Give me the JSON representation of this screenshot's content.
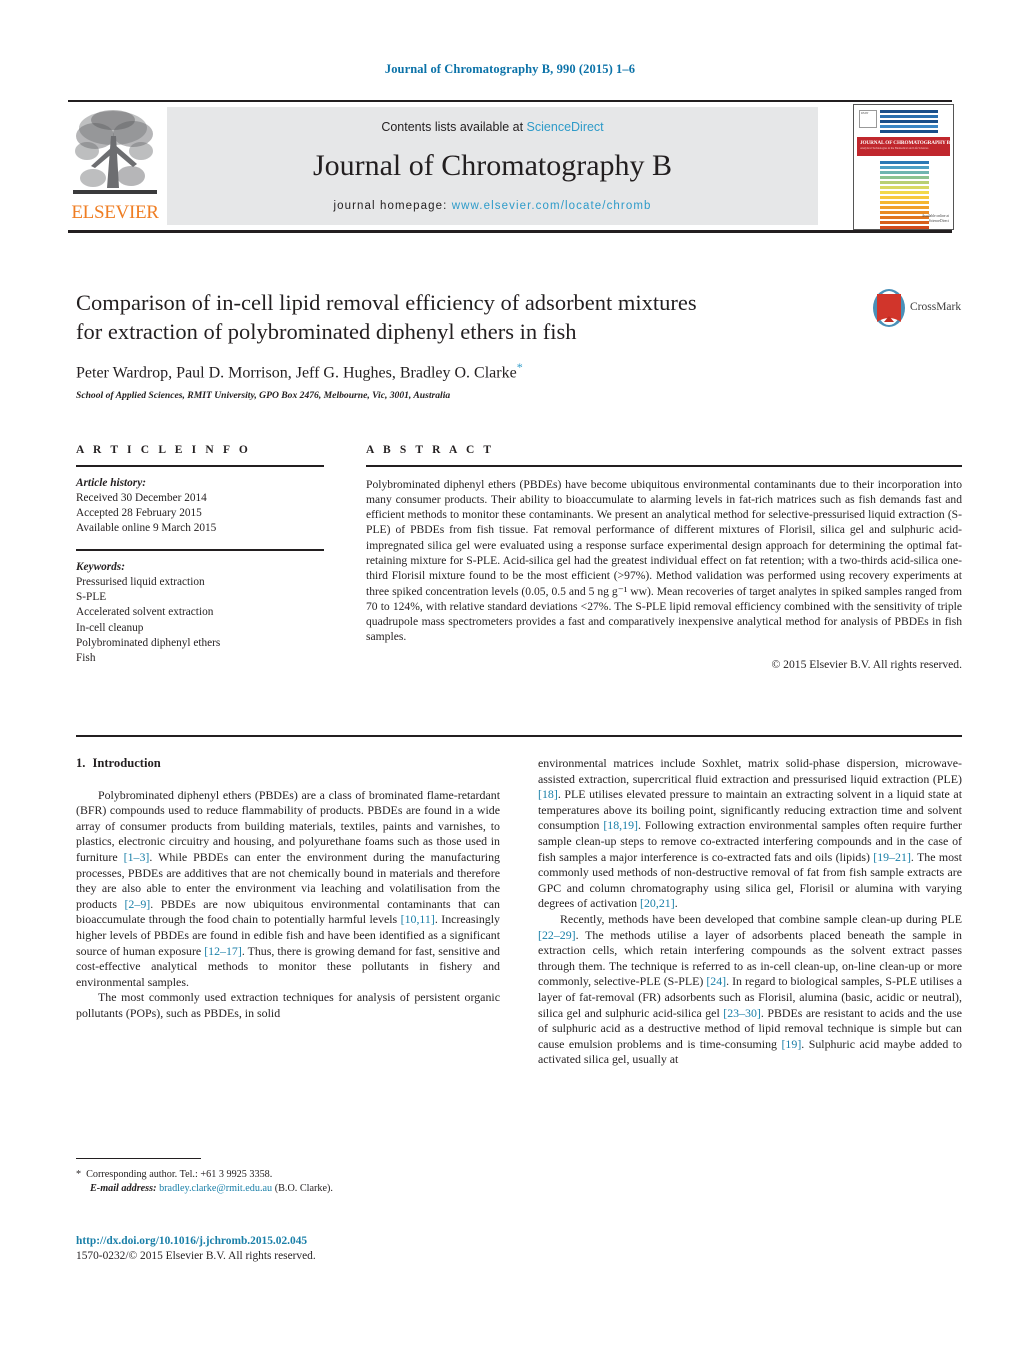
{
  "running_head": "Journal of Chromatography B, 990 (2015) 1–6",
  "masthead": {
    "contents_prefix": "Contents lists available at ",
    "contents_link": "ScienceDirect",
    "journal_name": "Journal of Chromatography B",
    "homepage_prefix": "journal homepage: ",
    "homepage_link": "www.elsevier.com/locate/chromb",
    "publisher_wordmark": "ELSEVIER",
    "cover": {
      "band_title": "JOURNAL OF CHROMATOGRAPHY B",
      "band_subtitle": "Analytical Technologies in the Biomedical and Life Sciences",
      "footer_line1": "Available online at",
      "footer_line2": "ScienceDirect"
    },
    "colors": {
      "link": "#2e9bc9",
      "panel": "#e6e7e8",
      "elsevier_orange": "#ef7d22",
      "cover_red": "#c0272d"
    }
  },
  "article": {
    "title_line1": "Comparison of in-cell lipid removal efficiency of adsorbent mixtures",
    "title_line2": "for extraction of polybrominated diphenyl ethers in fish",
    "authors": "Peter Wardrop, Paul D. Morrison, Jeff G. Hughes, Bradley O. Clarke",
    "corresponding_marker": "*",
    "affiliation": "School of Applied Sciences, RMIT University, GPO Box 2476, Melbourne, Vic, 3001, Australia",
    "crossmark_label": "CrossMark"
  },
  "article_info": {
    "heading": "A R T I C L E  I N F O",
    "history_label": "Article history:",
    "history": [
      "Received 30 December 2014",
      "Accepted 28 February 2015",
      "Available online 9 March 2015"
    ],
    "keywords_label": "Keywords:",
    "keywords": [
      "Pressurised liquid extraction",
      "S-PLE",
      "Accelerated solvent extraction",
      "In-cell cleanup",
      "Polybrominated diphenyl ethers",
      "Fish"
    ]
  },
  "abstract": {
    "heading": "A B S T R A C T",
    "body": "Polybrominated diphenyl ethers (PBDEs) have become ubiquitous environmental contaminants due to their incorporation into many consumer products. Their ability to bioaccumulate to alarming levels in fat-rich matrices such as fish demands fast and efficient methods to monitor these contaminants. We present an analytical method for selective-pressurised liquid extraction (S-PLE) of PBDEs from fish tissue. Fat removal performance of different mixtures of Florisil, silica gel and sulphuric acid-impregnated silica gel were evaluated using a response surface experimental design approach for determining the optimal fat-retaining mixture for S-PLE. Acid-silica gel had the greatest individual effect on fat retention; with a two-thirds acid-silica one-third Florisil mixture found to be the most efficient (>97%). Method validation was performed using recovery experiments at three spiked concentration levels (0.05, 0.5 and 5 ng g⁻¹ ww). Mean recoveries of target analytes in spiked samples ranged from 70 to 124%, with relative standard deviations <27%. The S-PLE lipid removal efficiency combined with the sensitivity of triple quadrupole mass spectrometers provides a fast and comparatively inexpensive analytical method for analysis of PBDEs in fish samples.",
    "copyright": "© 2015 Elsevier B.V. All rights reserved."
  },
  "introduction": {
    "number": "1.",
    "heading": "Introduction",
    "left_p1_a": "Polybrominated diphenyl ethers (PBDEs) are a class of brominated flame-retardant (BFR) compounds used to reduce flammability of products. PBDEs are found in a wide array of consumer products from building materials, textiles, paints and varnishes, to plastics, electronic circuitry and housing, and polyurethane foams such as those used in furniture ",
    "left_p1_r1": "[1–3]",
    "left_p1_b": ". While PBDEs can enter the environment during the manufacturing processes, PBDEs are additives that are not chemically bound in materials and therefore they are also able to enter the environment via leaching and volatilisation from the products ",
    "left_p1_r2": "[2–9]",
    "left_p1_c": ". PBDEs are now ubiquitous environmental contaminants that can bioaccumulate through the food chain to potentially harmful levels ",
    "left_p1_r3": "[10,11]",
    "left_p1_d": ". Increasingly higher levels of PBDEs are found in edible fish and have been identified as a significant source of human exposure ",
    "left_p1_r4": "[12–17]",
    "left_p1_e": ". Thus, there is growing demand for fast, sensitive and cost-effective analytical methods to monitor these pollutants in fishery and environmental samples.",
    "left_p2_a": "The most commonly used extraction techniques for analysis of persistent organic pollutants (POPs), such as PBDEs, in solid",
    "right_p1_a": "environmental matrices include Soxhlet, matrix solid-phase dispersion, microwave-assisted extraction, supercritical fluid extraction and pressurised liquid extraction (PLE) ",
    "right_p1_r1": "[18]",
    "right_p1_b": ". PLE utilises elevated pressure to maintain an extracting solvent in a liquid state at temperatures above its boiling point, significantly reducing extraction time and solvent consumption ",
    "right_p1_r2": "[18,19]",
    "right_p1_c": ". Following extraction environmental samples often require further sample clean-up steps to remove co-extracted interfering compounds and in the case of fish samples a major interference is co-extracted fats and oils (lipids) ",
    "right_p1_r3": "[19–21]",
    "right_p1_d": ". The most commonly used methods of non-destructive removal of fat from fish sample extracts are GPC and column chromatography using silica gel, Florisil or alumina with varying degrees of activation ",
    "right_p1_r4": "[20,21]",
    "right_p1_e": ".",
    "right_p2_a": "Recently, methods have been developed that combine sample clean-up during PLE ",
    "right_p2_r1": "[22–29]",
    "right_p2_b": ". The methods utilise a layer of adsorbents placed beneath the sample in extraction cells, which retain interfering compounds as the solvent extract passes through them. The technique is referred to as in-cell clean-up, on-line clean-up or more commonly, selective-PLE (S-PLE) ",
    "right_p2_r2": "[24]",
    "right_p2_c": ". In regard to biological samples, S-PLE utilises a layer of fat-removal (FR) adsorbents such as Florisil, alumina (basic, acidic or neutral), silica gel and sulphuric acid-silica gel ",
    "right_p2_r3": "[23–30]",
    "right_p2_d": ". PBDEs are resistant to acids and the use of sulphuric acid as a destructive method of lipid removal technique is simple but can cause emulsion problems and is time-consuming ",
    "right_p2_r4": "[19]",
    "right_p2_e": ". Sulphuric acid maybe added to activated silica gel, usually at"
  },
  "footer": {
    "corresponding_star": "*",
    "corresponding_text": "Corresponding author. Tel.: +61 3 9925 3358.",
    "email_label": "E-mail address:",
    "email": "bradley.clarke@rmit.edu.au",
    "email_suffix": "(B.O. Clarke).",
    "doi": "http://dx.doi.org/10.1016/j.jchromb.2015.02.045",
    "issn_line": "1570-0232/© 2015 Elsevier B.V. All rights reserved."
  }
}
